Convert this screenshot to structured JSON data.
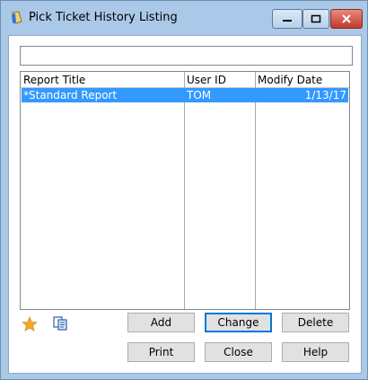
{
  "window": {
    "title": "Pick Ticket History Listing"
  },
  "search": {
    "value": ""
  },
  "grid": {
    "columns": [
      "Report Title",
      "User ID",
      "Modify Date"
    ],
    "rows": [
      {
        "title": "*Standard Report",
        "user": "TOM",
        "date": "1/13/17",
        "selected": true
      }
    ]
  },
  "buttons": {
    "add": "Add",
    "change": "Change",
    "delete": "Delete",
    "print": "Print",
    "close": "Close",
    "help": "Help"
  },
  "icons": {
    "app": "report-app-icon",
    "favorite": "star-icon",
    "copy": "copy-icon"
  },
  "colors": {
    "selection": "#3399ff",
    "default_button_border": "#0078d7",
    "title_bar": "#aac9e8"
  }
}
